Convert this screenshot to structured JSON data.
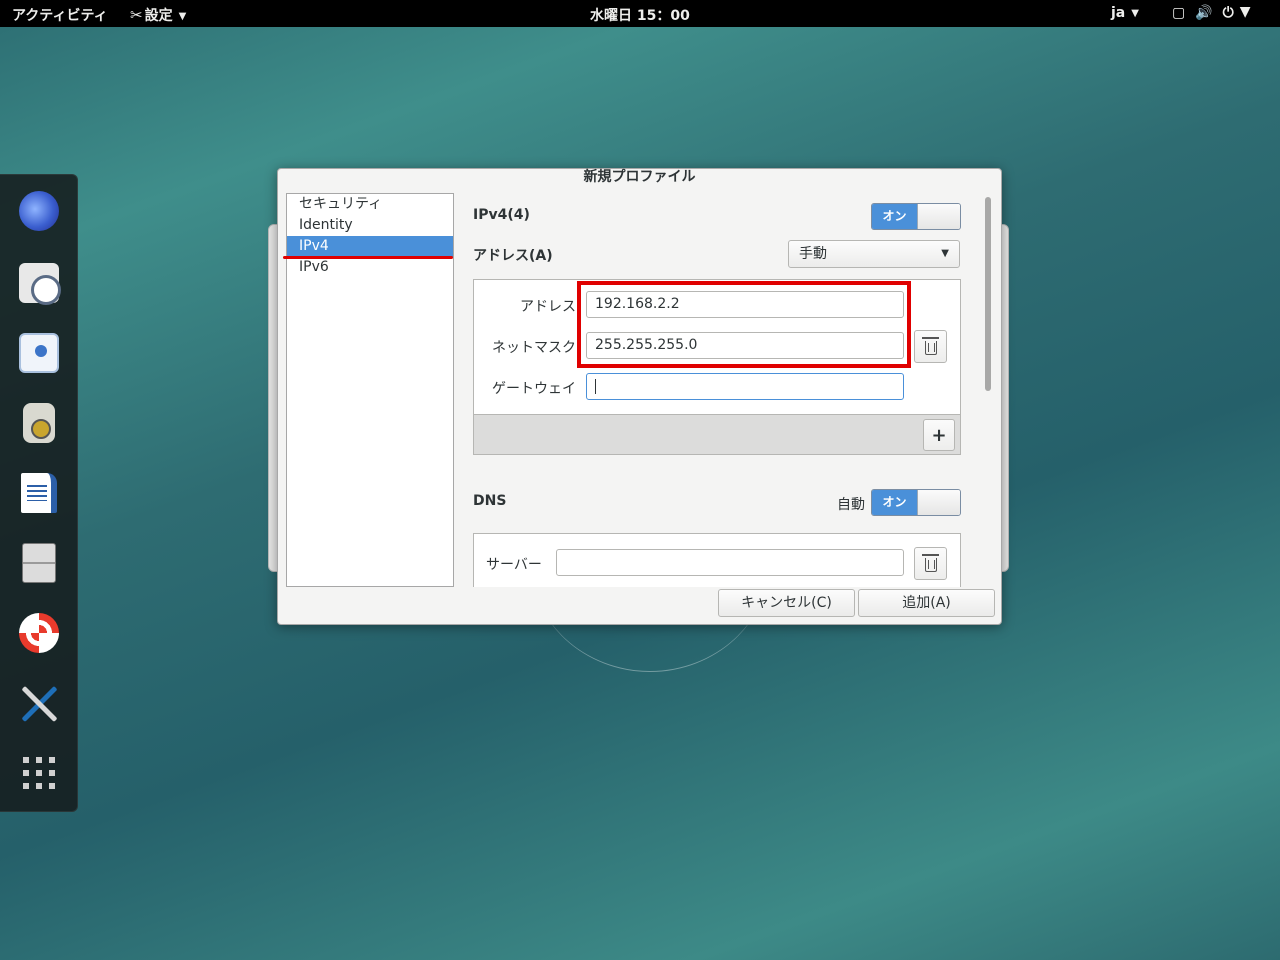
{
  "topbar": {
    "activities": "アクティビティ",
    "app_menu": "設定",
    "clock": "水曜日 15：00",
    "lang": "ja",
    "tray_icons": [
      "screen-icon",
      "volume-icon",
      "power-icon"
    ]
  },
  "dash": {
    "apps": [
      "evolution-icon",
      "clock-mail-icon",
      "chat-icon",
      "music-player-icon",
      "writer-icon",
      "files-icon",
      "help-icon",
      "settings-tools-icon",
      "show-apps-icon"
    ]
  },
  "dialog": {
    "title": "新規プロファイル",
    "sidebar": {
      "items": [
        {
          "label": "セキュリティ",
          "selected": false
        },
        {
          "label": "Identity",
          "selected": false
        },
        {
          "label": "IPv4",
          "selected": true
        },
        {
          "label": "IPv6",
          "selected": false
        }
      ]
    },
    "ipv4": {
      "title": "IPv4(4)",
      "switch_label": "オン",
      "switch_on": true,
      "address_section_label": "アドレス(A)",
      "method_value": "手動",
      "address_label": "アドレス",
      "address_value": "192.168.2.2",
      "netmask_label": "ネットマスク",
      "netmask_value": "255.255.255.0",
      "gateway_label": "ゲートウェイ",
      "gateway_value": ""
    },
    "dns": {
      "title": "DNS",
      "auto_label": "自動",
      "switch_label": "オン",
      "switch_on": true,
      "server_label": "サーバー",
      "server_value": ""
    },
    "buttons": {
      "cancel": "キャンセル(C)",
      "add": "追加(A)"
    }
  },
  "colors": {
    "accent": "#4a90d9",
    "annotation": "#e00000"
  }
}
